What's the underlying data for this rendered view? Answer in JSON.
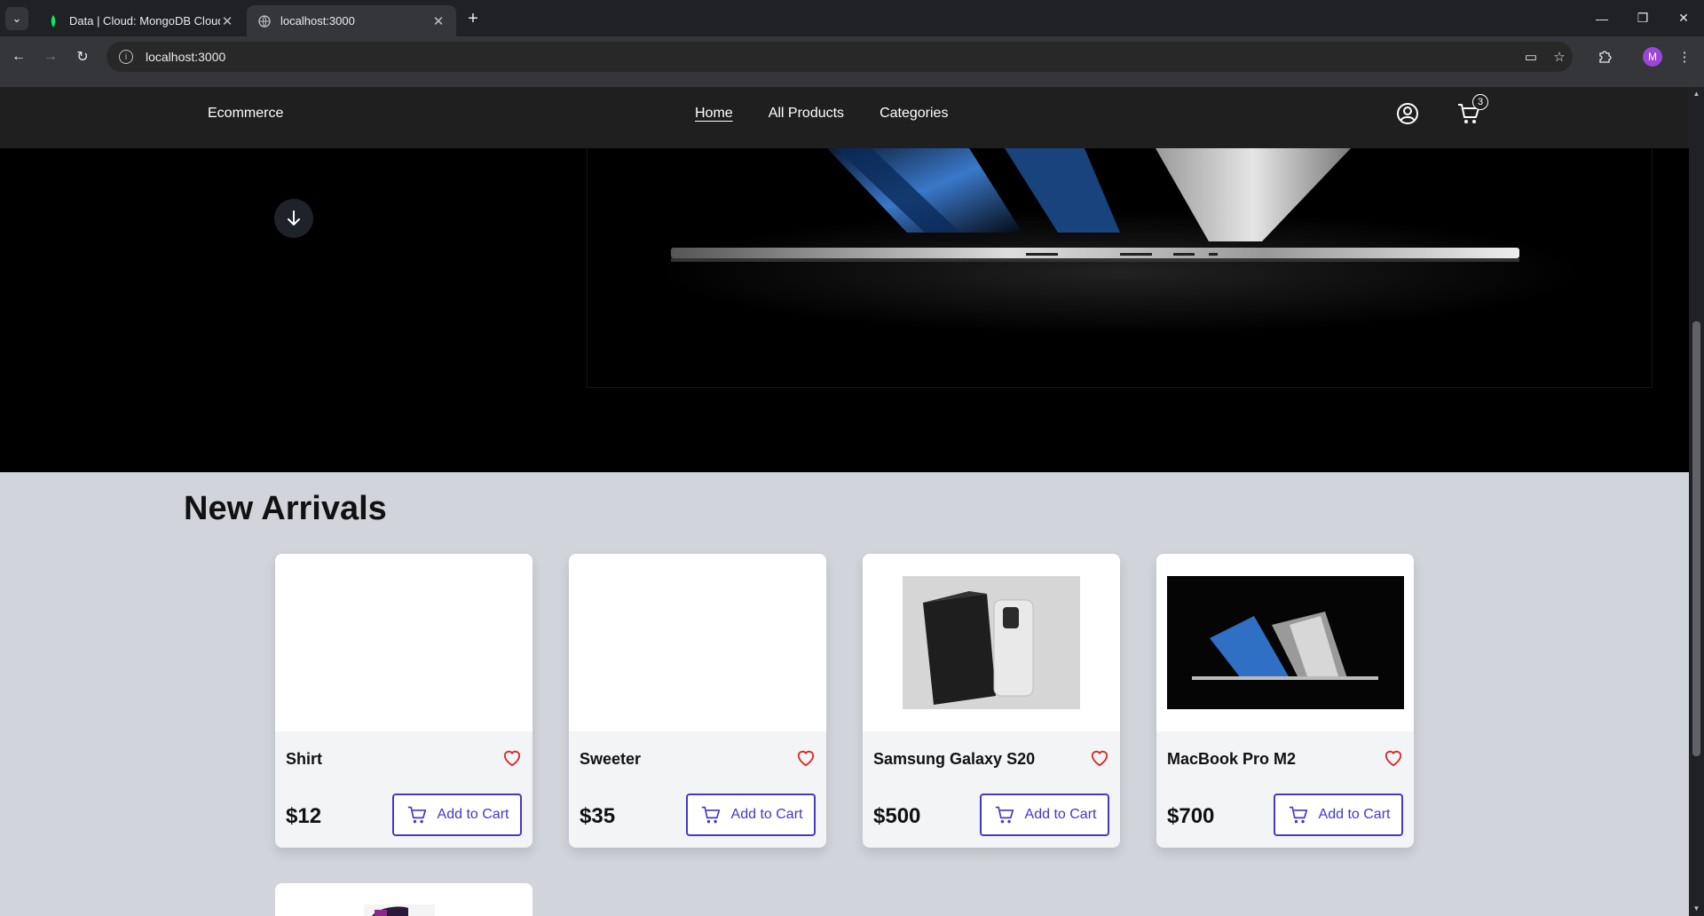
{
  "browser": {
    "tabs": [
      {
        "title": "Data | Cloud: MongoDB Cloud",
        "active": false
      },
      {
        "title": "localhost:3000",
        "active": true
      }
    ],
    "url": "localhost:3000",
    "profile_initial": "M"
  },
  "header": {
    "brand": "Ecommerce",
    "nav": [
      {
        "label": "Home",
        "active": true
      },
      {
        "label": "All Products",
        "active": false
      },
      {
        "label": "Categories",
        "active": false
      }
    ],
    "cart_count": "3"
  },
  "section": {
    "title": "New Arrivals"
  },
  "products": [
    {
      "name": "Shirt",
      "price": "$12",
      "button": "Add to Cart"
    },
    {
      "name": "Sweeter",
      "price": "$35",
      "button": "Add to Cart"
    },
    {
      "name": "Samsung Galaxy S20",
      "price": "$500",
      "button": "Add to Cart"
    },
    {
      "name": "MacBook Pro M2",
      "price": "$700",
      "button": "Add to Cart"
    }
  ],
  "colors": {
    "accent": "#4338ca",
    "heart": "#dc2626",
    "page_bg": "#d1d5db",
    "header_bg": "#1f1f1f"
  }
}
